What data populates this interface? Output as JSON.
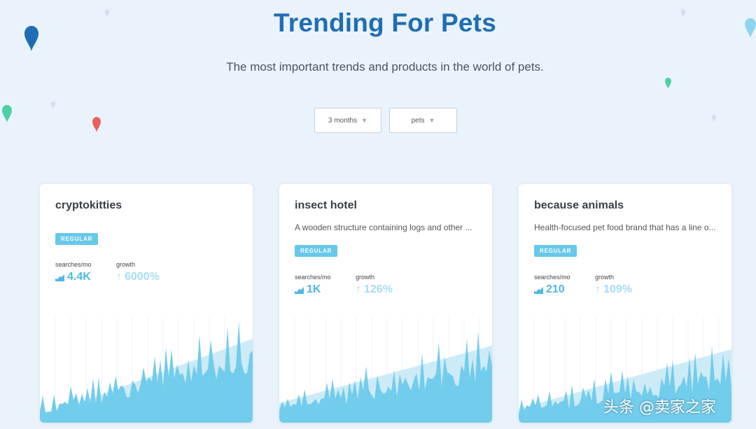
{
  "header": {
    "title": "Trending For Pets",
    "subtitle": "The most important trends and products in the world of pets."
  },
  "filters": {
    "time_range": "3 months",
    "category": "pets"
  },
  "colors": {
    "title": "#1f6db5",
    "badge": "#67c8ea",
    "chart_fill": "#72ccec",
    "chart_trend": "#cdebf7",
    "background": "#eaf3fb"
  },
  "cards": [
    {
      "title": "cryptokitties",
      "description": "",
      "badge": "REGULAR",
      "searches_label": "searches/mo",
      "searches_value": "4.4K",
      "growth_label": "growth",
      "growth_value": "6000%"
    },
    {
      "title": "insect hotel",
      "description": "A wooden structure containing logs and other ...",
      "badge": "REGULAR",
      "searches_label": "searches/mo",
      "searches_value": "1K",
      "growth_label": "growth",
      "growth_value": "126%"
    },
    {
      "title": "because animals",
      "description": "Health-focused pet food brand that has a line o...",
      "badge": "REGULAR",
      "searches_label": "searches/mo",
      "searches_value": "210",
      "growth_label": "growth",
      "growth_value": "109%"
    }
  ],
  "watermark": "头条 @卖家之家"
}
